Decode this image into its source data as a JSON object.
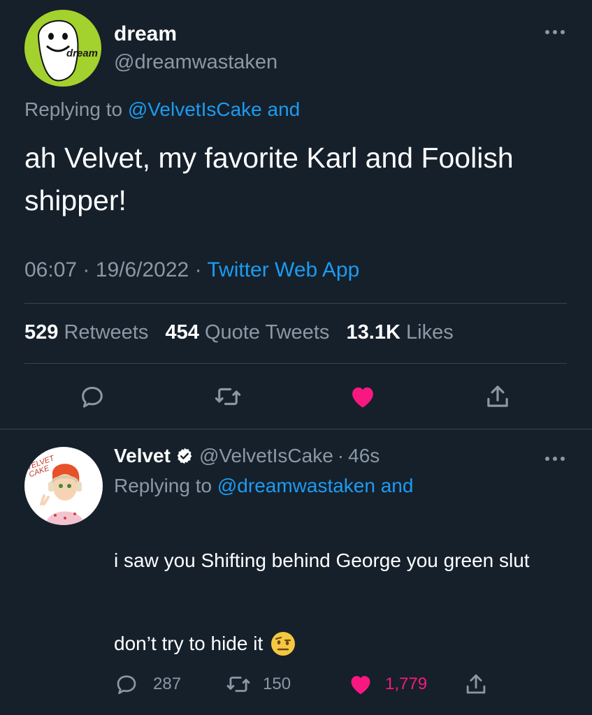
{
  "main_tweet": {
    "avatar_text": "dream",
    "display_name": "dream",
    "handle": "@dreamwastaken",
    "replying_prefix": "Replying to",
    "replying_to": "@VelvetIsCake and",
    "text": "ah Velvet, my favorite Karl and Foolish shipper!",
    "time": "06:07",
    "date": "19/6/2022",
    "separator": "·",
    "source": "Twitter Web App",
    "stats": {
      "retweets_count": "529",
      "retweets_label": "Retweets",
      "quotes_count": "454",
      "quotes_label": "Quote Tweets",
      "likes_count": "13.1K",
      "likes_label": "Likes"
    },
    "icons": [
      "reply-icon",
      "retweet-icon",
      "like-icon-filled",
      "share-icon"
    ]
  },
  "reply_tweet": {
    "avatar_text": "VELVET CAKE",
    "display_name": "Velvet",
    "handle": "@VelvetIsCake",
    "separator": "·",
    "time_ago": "46s",
    "replying_prefix": "Replying to",
    "replying_to": "@dreamwastaken and",
    "text_line1": "i saw you Shifting behind George you green slut",
    "text_line2": "don’t try to hide it",
    "counts": {
      "replies": "287",
      "retweets": "150",
      "likes": "1,779"
    }
  },
  "colors": {
    "background": "#15202b",
    "text": "#ffffff",
    "muted": "#8b98a5",
    "link": "#1d9bf0",
    "like": "#f91880",
    "divider": "#38444d",
    "dream_green": "#a3d12d"
  }
}
